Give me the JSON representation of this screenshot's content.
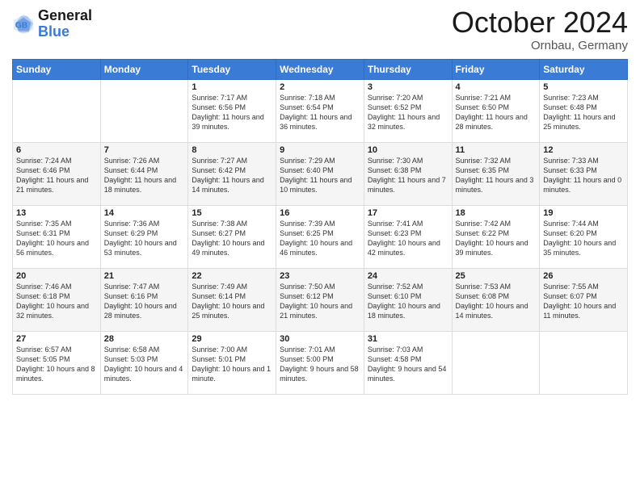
{
  "header": {
    "logo_line1": "General",
    "logo_line2": "Blue",
    "month": "October 2024",
    "location": "Ornbau, Germany"
  },
  "weekdays": [
    "Sunday",
    "Monday",
    "Tuesday",
    "Wednesday",
    "Thursday",
    "Friday",
    "Saturday"
  ],
  "weeks": [
    [
      {
        "day": "",
        "info": ""
      },
      {
        "day": "",
        "info": ""
      },
      {
        "day": "1",
        "info": "Sunrise: 7:17 AM\nSunset: 6:56 PM\nDaylight: 11 hours and 39 minutes."
      },
      {
        "day": "2",
        "info": "Sunrise: 7:18 AM\nSunset: 6:54 PM\nDaylight: 11 hours and 36 minutes."
      },
      {
        "day": "3",
        "info": "Sunrise: 7:20 AM\nSunset: 6:52 PM\nDaylight: 11 hours and 32 minutes."
      },
      {
        "day": "4",
        "info": "Sunrise: 7:21 AM\nSunset: 6:50 PM\nDaylight: 11 hours and 28 minutes."
      },
      {
        "day": "5",
        "info": "Sunrise: 7:23 AM\nSunset: 6:48 PM\nDaylight: 11 hours and 25 minutes."
      }
    ],
    [
      {
        "day": "6",
        "info": "Sunrise: 7:24 AM\nSunset: 6:46 PM\nDaylight: 11 hours and 21 minutes."
      },
      {
        "day": "7",
        "info": "Sunrise: 7:26 AM\nSunset: 6:44 PM\nDaylight: 11 hours and 18 minutes."
      },
      {
        "day": "8",
        "info": "Sunrise: 7:27 AM\nSunset: 6:42 PM\nDaylight: 11 hours and 14 minutes."
      },
      {
        "day": "9",
        "info": "Sunrise: 7:29 AM\nSunset: 6:40 PM\nDaylight: 11 hours and 10 minutes."
      },
      {
        "day": "10",
        "info": "Sunrise: 7:30 AM\nSunset: 6:38 PM\nDaylight: 11 hours and 7 minutes."
      },
      {
        "day": "11",
        "info": "Sunrise: 7:32 AM\nSunset: 6:35 PM\nDaylight: 11 hours and 3 minutes."
      },
      {
        "day": "12",
        "info": "Sunrise: 7:33 AM\nSunset: 6:33 PM\nDaylight: 11 hours and 0 minutes."
      }
    ],
    [
      {
        "day": "13",
        "info": "Sunrise: 7:35 AM\nSunset: 6:31 PM\nDaylight: 10 hours and 56 minutes."
      },
      {
        "day": "14",
        "info": "Sunrise: 7:36 AM\nSunset: 6:29 PM\nDaylight: 10 hours and 53 minutes."
      },
      {
        "day": "15",
        "info": "Sunrise: 7:38 AM\nSunset: 6:27 PM\nDaylight: 10 hours and 49 minutes."
      },
      {
        "day": "16",
        "info": "Sunrise: 7:39 AM\nSunset: 6:25 PM\nDaylight: 10 hours and 46 minutes."
      },
      {
        "day": "17",
        "info": "Sunrise: 7:41 AM\nSunset: 6:23 PM\nDaylight: 10 hours and 42 minutes."
      },
      {
        "day": "18",
        "info": "Sunrise: 7:42 AM\nSunset: 6:22 PM\nDaylight: 10 hours and 39 minutes."
      },
      {
        "day": "19",
        "info": "Sunrise: 7:44 AM\nSunset: 6:20 PM\nDaylight: 10 hours and 35 minutes."
      }
    ],
    [
      {
        "day": "20",
        "info": "Sunrise: 7:46 AM\nSunset: 6:18 PM\nDaylight: 10 hours and 32 minutes."
      },
      {
        "day": "21",
        "info": "Sunrise: 7:47 AM\nSunset: 6:16 PM\nDaylight: 10 hours and 28 minutes."
      },
      {
        "day": "22",
        "info": "Sunrise: 7:49 AM\nSunset: 6:14 PM\nDaylight: 10 hours and 25 minutes."
      },
      {
        "day": "23",
        "info": "Sunrise: 7:50 AM\nSunset: 6:12 PM\nDaylight: 10 hours and 21 minutes."
      },
      {
        "day": "24",
        "info": "Sunrise: 7:52 AM\nSunset: 6:10 PM\nDaylight: 10 hours and 18 minutes."
      },
      {
        "day": "25",
        "info": "Sunrise: 7:53 AM\nSunset: 6:08 PM\nDaylight: 10 hours and 14 minutes."
      },
      {
        "day": "26",
        "info": "Sunrise: 7:55 AM\nSunset: 6:07 PM\nDaylight: 10 hours and 11 minutes."
      }
    ],
    [
      {
        "day": "27",
        "info": "Sunrise: 6:57 AM\nSunset: 5:05 PM\nDaylight: 10 hours and 8 minutes."
      },
      {
        "day": "28",
        "info": "Sunrise: 6:58 AM\nSunset: 5:03 PM\nDaylight: 10 hours and 4 minutes."
      },
      {
        "day": "29",
        "info": "Sunrise: 7:00 AM\nSunset: 5:01 PM\nDaylight: 10 hours and 1 minute."
      },
      {
        "day": "30",
        "info": "Sunrise: 7:01 AM\nSunset: 5:00 PM\nDaylight: 9 hours and 58 minutes."
      },
      {
        "day": "31",
        "info": "Sunrise: 7:03 AM\nSunset: 4:58 PM\nDaylight: 9 hours and 54 minutes."
      },
      {
        "day": "",
        "info": ""
      },
      {
        "day": "",
        "info": ""
      }
    ]
  ]
}
